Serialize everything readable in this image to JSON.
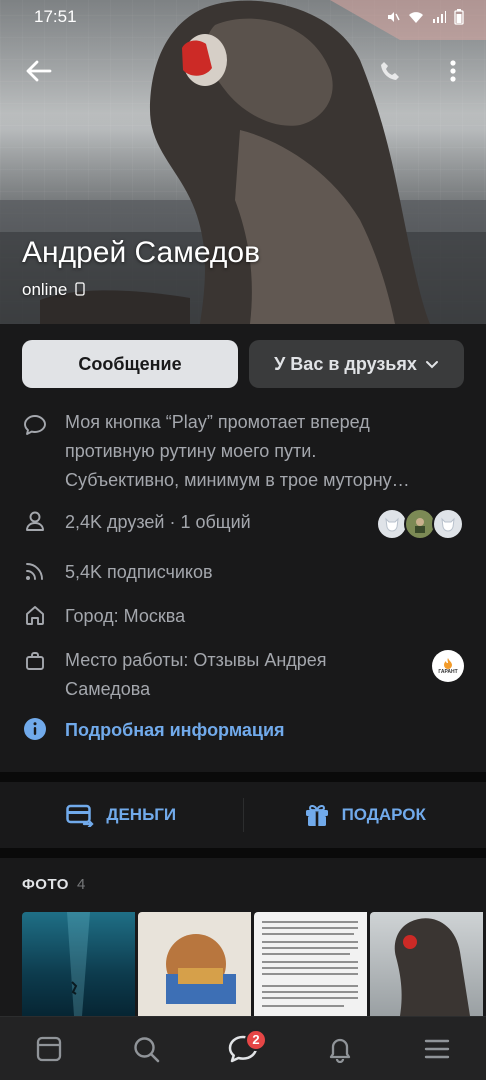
{
  "status_bar": {
    "time": "17:51"
  },
  "profile": {
    "name": "Андрей Самедов",
    "status": "online"
  },
  "actions": {
    "message": "Сообщение",
    "friends": "У Вас в друзьях"
  },
  "info": {
    "about_lines": [
      "Моя кнопка “Play” промотает вперед",
      "противную рутину моего пути.",
      "Субъективно, минимум в трое муторну…"
    ],
    "friends": "2,4K друзей · 1 общий",
    "followers": "5,4K подписчиков",
    "city": "Город: Москва",
    "work_lines": [
      "Место работы: Отзывы Андрея",
      "Самедова"
    ],
    "work_logo_text": "ГАРАНТ",
    "details_link": "Подробная информация"
  },
  "money_bar": {
    "money": "ДЕНЬГИ",
    "gift": "ПОДАРОК"
  },
  "photos": {
    "title": "ФОТО",
    "count": "4"
  },
  "tabbar": {
    "messages_badge": "2"
  },
  "colors": {
    "background": "#19191a",
    "accent": "#71aaeb",
    "badge": "#e64646"
  }
}
